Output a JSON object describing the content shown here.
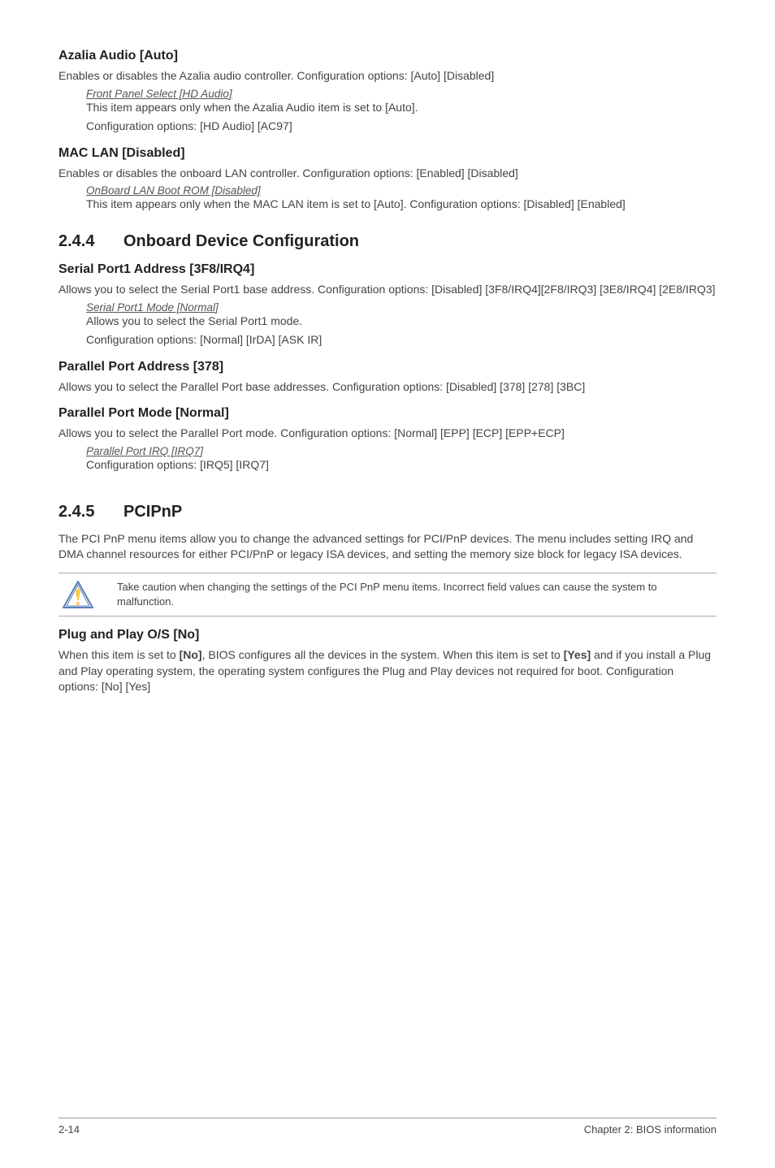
{
  "sections": {
    "azalia": {
      "heading": "Azalia Audio [Auto]",
      "desc": "Enables or disables the Azalia audio controller. Configuration options: [Auto] [Disabled]",
      "sub_heading": "Front Panel Select [HD Audio]",
      "sub_line1": "This item appears only when the Azalia Audio item is set to [Auto].",
      "sub_line2": "Configuration options: [HD Audio] [AC97]"
    },
    "maclan": {
      "heading": "MAC LAN [Disabled]",
      "desc": "Enables or disables the onboard LAN controller. Configuration options: [Enabled] [Disabled]",
      "sub_heading": "OnBoard LAN Boot ROM [Disabled]",
      "sub_line1": "This item appears only when the MAC LAN item is set to [Auto]. Configuration options: [Disabled] [Enabled]"
    },
    "onboard": {
      "num": "2.4.4",
      "title": "Onboard Device Configuration"
    },
    "serial": {
      "heading": "Serial Port1 Address [3F8/IRQ4]",
      "desc": "Allows you to select the Serial Port1 base address. Configuration options: [Disabled] [3F8/IRQ4][2F8/IRQ3] [3E8/IRQ4] [2E8/IRQ3]",
      "sub_heading": "Serial Port1 Mode [Normal]",
      "sub_line1": "Allows you to select the Serial Port1 mode.",
      "sub_line2": "Configuration options: [Normal] [IrDA] [ASK IR]"
    },
    "parallelAddr": {
      "heading": "Parallel Port Address [378]",
      "desc": "Allows you to select the Parallel Port base addresses. Configuration options: [Disabled] [378] [278] [3BC]"
    },
    "parallelMode": {
      "heading": "Parallel Port Mode [Normal]",
      "desc": "Allows you to select the Parallel Port  mode. Configuration options: [Normal] [EPP] [ECP] [EPP+ECP]",
      "sub_heading": "Parallel Port IRQ [IRQ7]",
      "sub_line1": "Configuration options: [IRQ5] [IRQ7]"
    },
    "pcipnp": {
      "num": "2.4.5",
      "title": "PCIPnP",
      "desc": "The PCI PnP menu items allow you to change the advanced settings for PCI/PnP devices. The menu includes setting IRQ and DMA channel resources for either PCI/PnP or legacy ISA devices, and setting the memory size block for legacy ISA devices.",
      "callout": "Take caution when changing the settings of the PCI PnP menu items. Incorrect field values can cause the system to malfunction."
    },
    "plugplay": {
      "heading": "Plug and Play O/S [No]",
      "desc_pre": "When this item is set to ",
      "desc_bold1": "[No]",
      "desc_mid": ", BIOS configures all the devices in the system. When this item is set to ",
      "desc_bold2": "[Yes]",
      "desc_post": " and if you install a Plug and Play operating system, the operating system configures the Plug and Play devices not required for boot. Configuration options: [No] [Yes]"
    }
  },
  "footer": {
    "page": "2-14",
    "chapter": "Chapter 2: BIOS information"
  }
}
